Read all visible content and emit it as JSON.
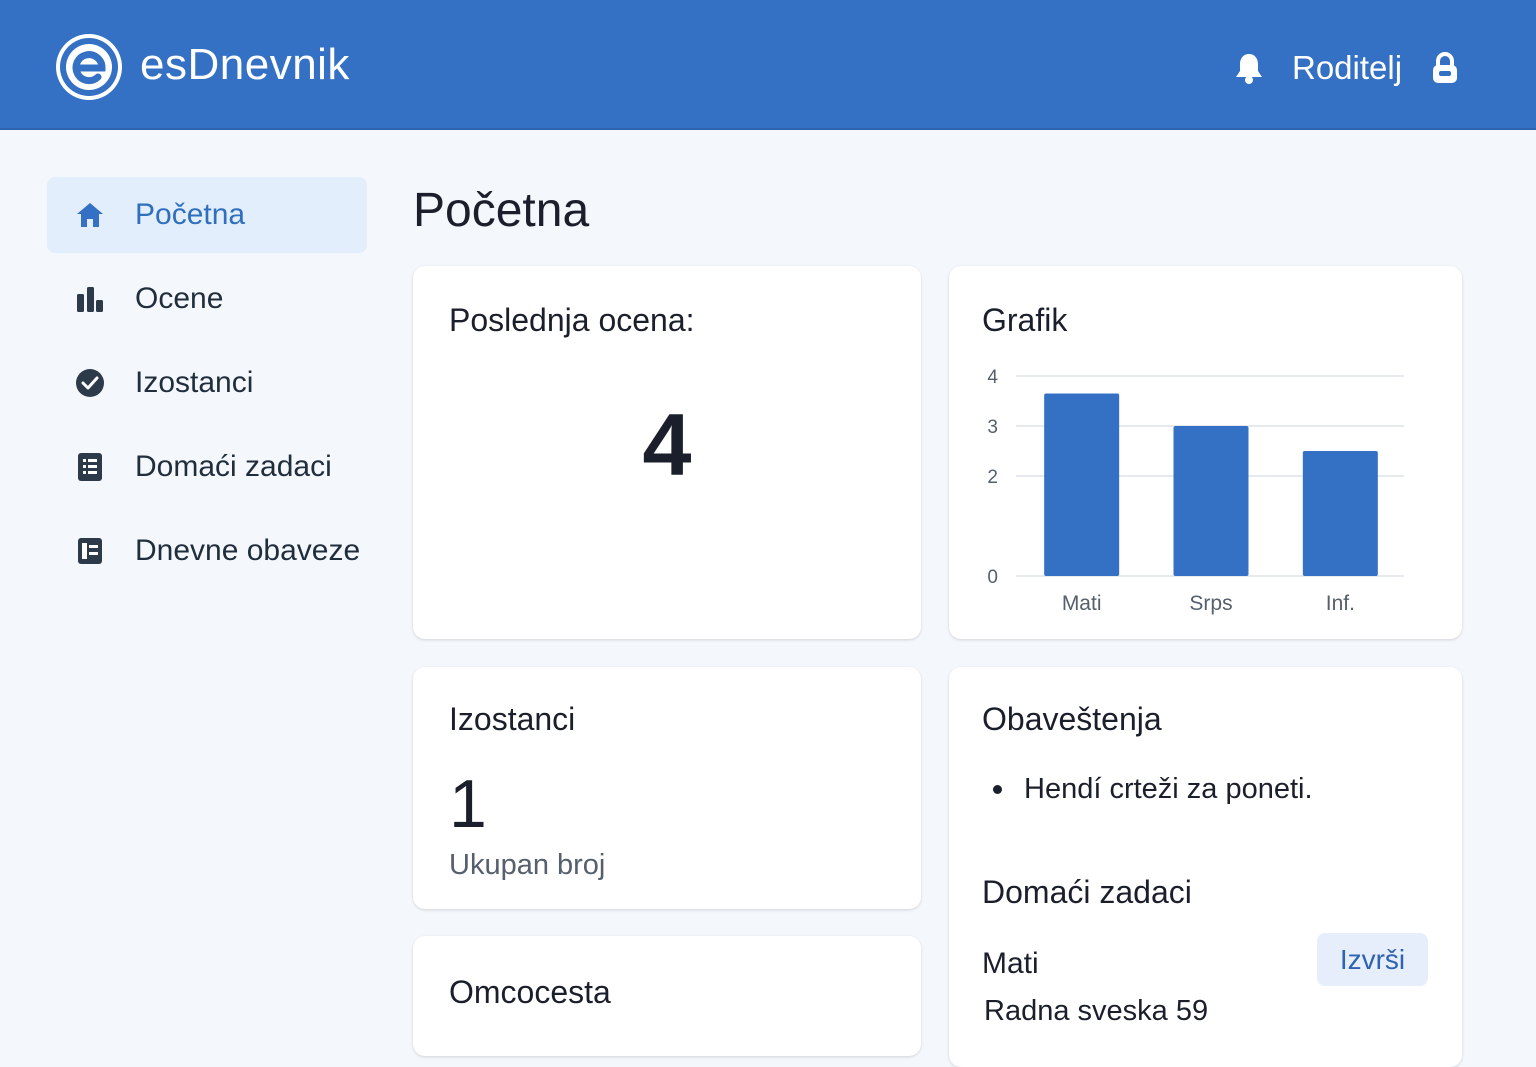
{
  "header": {
    "app_title": "esDnevnik",
    "logo_letter": "e",
    "user_label": "Roditelj",
    "icons": [
      "bell-icon",
      "lock-icon"
    ]
  },
  "colors": {
    "brand": "#3470c4",
    "active_nav_bg": "#e2eefb",
    "active_nav_text": "#2f6fbe",
    "bar": "#3470c4",
    "button_bg": "#e5eefa",
    "button_text": "#2f62b0"
  },
  "sidebar": {
    "items": [
      {
        "label": "Početna",
        "icon": "home-icon",
        "active": true
      },
      {
        "label": "Ocene",
        "icon": "grades-icon",
        "active": false
      },
      {
        "label": "Izostanci",
        "icon": "check-circle-icon",
        "active": false
      },
      {
        "label": "Domaći zadaci",
        "icon": "list-icon",
        "active": false
      },
      {
        "label": "Dnevne obaveze",
        "icon": "schedule-icon",
        "active": false
      }
    ]
  },
  "main": {
    "page_title": "Početna",
    "last_grade": {
      "title": "Poslednja ocena:",
      "value": "4"
    },
    "chart": {
      "title": "Grafik"
    },
    "absences": {
      "title": "Izostanci",
      "value": "1",
      "subtitle": "Ukupan broj"
    },
    "partial_card": {
      "title": "Omcocesta"
    },
    "notices": {
      "title": "Obaveštenja",
      "items": [
        "Hendí crteži za poneti."
      ],
      "homework_title": "Domaći zadaci",
      "homework_subject": "Mati",
      "homework_button": "Izvrši",
      "homework_task": "Radna sveska 59"
    }
  },
  "chart_data": {
    "type": "bar",
    "title": "Grafik",
    "categories": [
      "Mati",
      "Srps",
      "Inf."
    ],
    "values": [
      3.65,
      3.0,
      2.5
    ],
    "yticks": [
      "0",
      "2",
      "3",
      "4"
    ],
    "ylim": [
      0,
      4
    ],
    "grid": true,
    "xlabel": "",
    "ylabel": ""
  }
}
